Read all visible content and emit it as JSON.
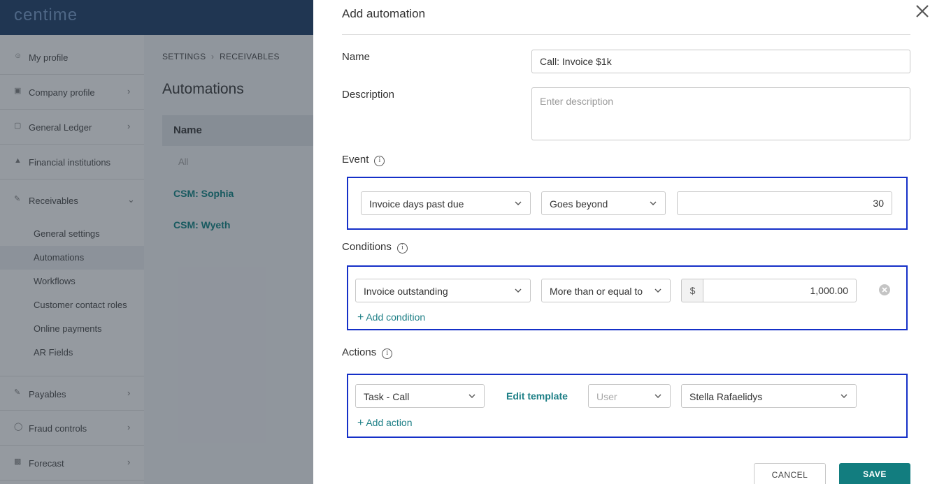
{
  "app": {
    "logo": "centime",
    "breadcrumb": [
      "SETTINGS",
      "RECEIVABLES"
    ],
    "page_title": "Automations",
    "sidebar": {
      "items": [
        {
          "label": "My profile",
          "icon": "user-icon",
          "chevron": false
        },
        {
          "label": "Company profile",
          "icon": "building-icon",
          "chevron": true
        },
        {
          "label": "General Ledger",
          "icon": "ledger-icon",
          "chevron": true
        },
        {
          "label": "Financial institutions",
          "icon": "bank-icon",
          "chevron": false
        },
        {
          "label": "Receivables",
          "icon": "receivables-icon",
          "chevron": true
        }
      ],
      "sub_items": [
        "General settings",
        "Automations",
        "Workflows",
        "Customer contact roles",
        "Online payments",
        "AR Fields"
      ],
      "active_sub": "Automations",
      "bottom_items": [
        {
          "label": "Payables",
          "icon": "payables-icon"
        },
        {
          "label": "Fraud controls",
          "icon": "shield-icon"
        },
        {
          "label": "Forecast",
          "icon": "chart-icon"
        }
      ]
    },
    "table": {
      "header": "Name",
      "filter": "All",
      "rows": [
        "CSM: Sophia",
        "CSM: Wyeth"
      ]
    }
  },
  "modal": {
    "title": "Add automation",
    "name_label": "Name",
    "name_value": "Call: Invoice $1k",
    "description_label": "Description",
    "description_placeholder": "Enter description",
    "event": {
      "label": "Event",
      "type": "Invoice days past due",
      "operator": "Goes beyond",
      "value": "30"
    },
    "conditions": {
      "label": "Conditions",
      "type": "Invoice outstanding",
      "operator": "More than or equal to",
      "currency": "$",
      "value": "1,000.00",
      "add_label": "Add condition"
    },
    "actions": {
      "label": "Actions",
      "type": "Task - Call",
      "edit_template": "Edit template",
      "assignee_type": "User",
      "assignee": "Stella Rafaelidys",
      "add_label": "Add action"
    },
    "cancel_label": "CANCEL",
    "save_label": "SAVE"
  },
  "colors": {
    "accent": "#127d7f",
    "link": "#1d7f86",
    "highlight": "#1530c8",
    "topbar": "#2b4a72"
  }
}
